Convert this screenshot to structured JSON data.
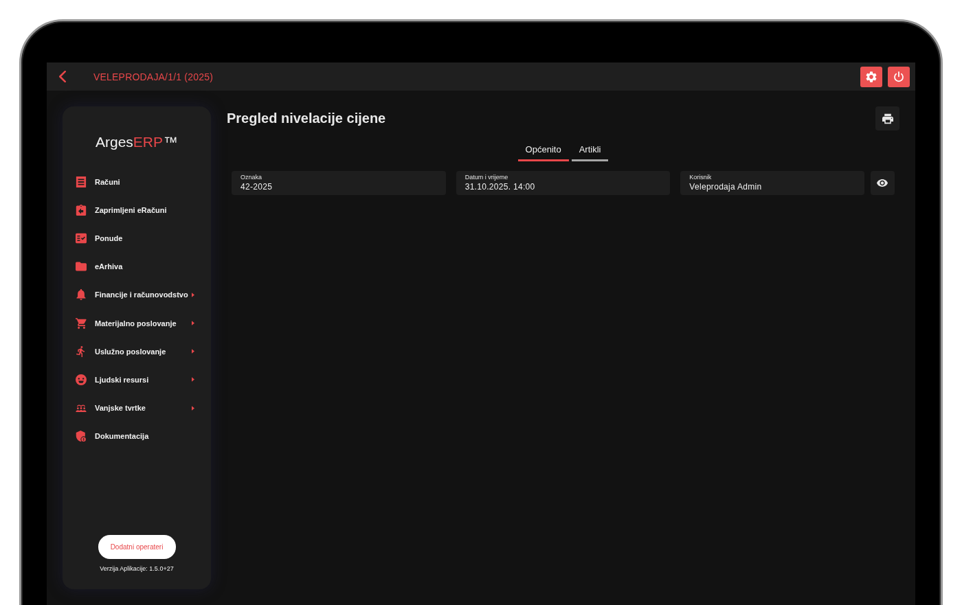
{
  "top_bar": {
    "title": "VELEPRODAJA/1/1 (2025)"
  },
  "sidebar": {
    "logo": {
      "text": "Arges",
      "accent": "ERP",
      "mark": "™"
    },
    "items": [
      {
        "label": "Računi",
        "has_submenu": false
      },
      {
        "label": "Zaprimljeni eRačuni",
        "has_submenu": false
      },
      {
        "label": "Ponude",
        "has_submenu": false
      },
      {
        "label": "eArhiva",
        "has_submenu": false
      },
      {
        "label": "Financije i računovodstvo",
        "has_submenu": true
      },
      {
        "label": "Materijalno poslovanje",
        "has_submenu": true
      },
      {
        "label": "Uslužno poslovanje",
        "has_submenu": true
      },
      {
        "label": "Ljudski resursi",
        "has_submenu": true
      },
      {
        "label": "Vanjske tvrtke",
        "has_submenu": true
      },
      {
        "label": "Dokumentacija",
        "has_submenu": false
      }
    ],
    "button": "Dodatni operateri",
    "version": "Verzija Aplikacije: 1.5.0+27"
  },
  "page": {
    "title": "Pregled nivelacije cijene",
    "tabs": [
      {
        "label": "Općenito",
        "selected": true
      },
      {
        "label": "Artikli",
        "selected": false
      }
    ],
    "fields": [
      {
        "label": "Oznaka",
        "value": "42-2025"
      },
      {
        "label": "Datum i vrijeme",
        "value": "31.10.2025. 14:00"
      },
      {
        "label": "Korisnik",
        "value": "Veleprodaja Admin"
      }
    ]
  }
}
